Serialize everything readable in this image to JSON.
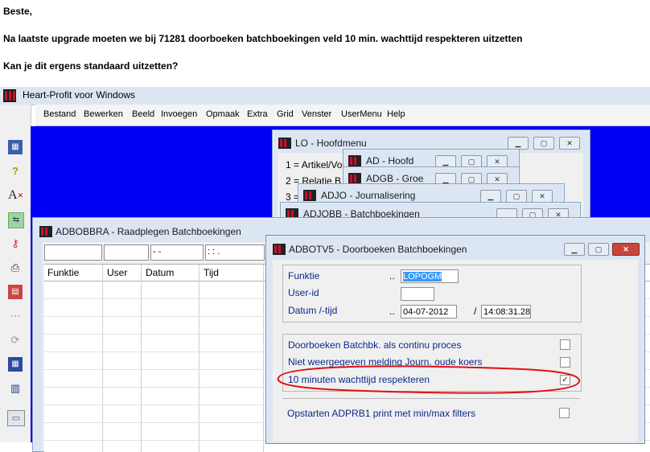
{
  "email": {
    "greeting": "Beste,",
    "line1": "Na laatste upgrade moeten we bij 71281 doorboeken batchboekingen veld 10 min. wachttijd respekteren uitzetten",
    "line2": "Kan je dit ergens standaard uitzetten?"
  },
  "app": {
    "title": "Heart-Profit voor Windows",
    "menu": [
      "Bestand",
      "Bewerken",
      "Beeld",
      "Invoegen",
      "Opmaak",
      "Extra",
      "Grid",
      "Venster",
      "UserMenu",
      "Help"
    ]
  },
  "toolbar_icons": [
    "calendar-icon",
    "help-icon",
    "spellcheck-icon",
    "transfer-icon",
    "key-icon",
    "printer-icon",
    "report-icon",
    "dots-icon",
    "refresh-icon",
    "calendar-lock-icon",
    "chart-icon",
    "window-icon"
  ],
  "windows": {
    "lo": {
      "title": "LO - Hoofdmenu",
      "items": [
        "1 = Artikel/Vo",
        "2 = Relatie B",
        "3 ="
      ]
    },
    "ad": {
      "title": "AD - Hoofd"
    },
    "adgb": {
      "title": "ADGB - Groe"
    },
    "adjo": {
      "title": "ADJO - Journalisering"
    },
    "adjobb": {
      "title": "ADJOBB - Batchboekingen"
    },
    "adbobbra": {
      "title": "ADBOBBRA - Raadplegen Batchboekingen",
      "filter_date": "- -",
      "filter_time": ": : .",
      "columns": [
        "Funktie",
        "User",
        "Datum",
        "Tijd"
      ]
    },
    "adbotv5": {
      "title": "ADBOTV5 - Doorboeken Batchboekingen",
      "funktie_label": "Funktie",
      "funktie_value": "LOPOGM",
      "userid_label": "User-id",
      "userid_value": "",
      "datum_label": "Datum /-tijd",
      "dots": "..",
      "datum_value": "04-07-2012",
      "slash": "/",
      "tijd_value": "14:08:31.28",
      "options": [
        {
          "label": "Doorboeken Batchbk. als continu proces",
          "checked": false
        },
        {
          "label": "Niet weergegeven melding Journ. oude koers",
          "checked": false
        },
        {
          "label": "10 minuten wachttijd respekteren",
          "checked": true
        }
      ],
      "print_option": {
        "label": "Opstarten ADPRB1 print met min/max filters",
        "checked": false
      }
    }
  }
}
